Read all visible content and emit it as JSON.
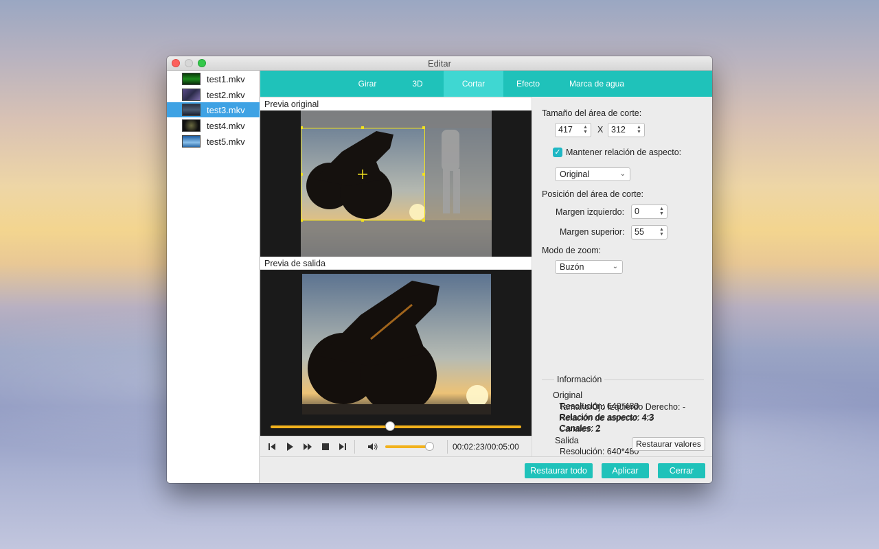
{
  "window": {
    "title": "Editar"
  },
  "files": [
    {
      "label": "test1.mkv",
      "selected": false
    },
    {
      "label": "test2.mkv",
      "selected": false
    },
    {
      "label": "test3.mkv",
      "selected": true
    },
    {
      "label": "test4.mkv",
      "selected": false
    },
    {
      "label": "test5.mkv",
      "selected": false
    }
  ],
  "tabs": [
    "Girar",
    "3D",
    "Cortar",
    "Efecto",
    "Marca de agua"
  ],
  "active_tab": "Cortar",
  "preview": {
    "original_label": "Previa original",
    "output_label": "Previa de salida"
  },
  "player": {
    "timecode": "00:02:23/00:05:00",
    "progress": 0.477,
    "volume": 0.88
  },
  "settings": {
    "crop_size_label": "Tamaño del área de corte:",
    "width": "417",
    "x_label": "X",
    "height": "312",
    "keep_ratio_label": "Mantener relación de aspecto:",
    "keep_ratio_checked": true,
    "ratio_value": "Original",
    "crop_position_label": "Posición del área de corte:",
    "left_margin_label": "Margen izquierdo:",
    "left_margin": "0",
    "top_margin_label": "Margen superior:",
    "top_margin": "55",
    "zoom_mode_label": "Modo de zoom:",
    "zoom_mode": "Buzón"
  },
  "info": {
    "title": "Información",
    "original_heading": "Original",
    "original_resolution": "Resolución: 640*480",
    "original_ratio": "Relación de aspecto: 4:3",
    "original_channels": "Canales: 2",
    "output_heading": "Salida",
    "output_resolution": "Resolución: 640*480",
    "output_eye_size": "Tamaño/Ojo Izquierdo Derecho: -",
    "output_ratio": "Relación de aspecto: 4:3",
    "output_channels": "Canales: 2",
    "reset_values_label": "Restaurar valores"
  },
  "footer": {
    "reset_all_label": "Restaurar todo",
    "apply_label": "Aplicar",
    "close_label": "Cerrar"
  },
  "colors": {
    "accent": "#1fc2ba",
    "selection": "#3ea2e4",
    "progress": "#f2b21d",
    "crop_box": "#f0e020"
  }
}
